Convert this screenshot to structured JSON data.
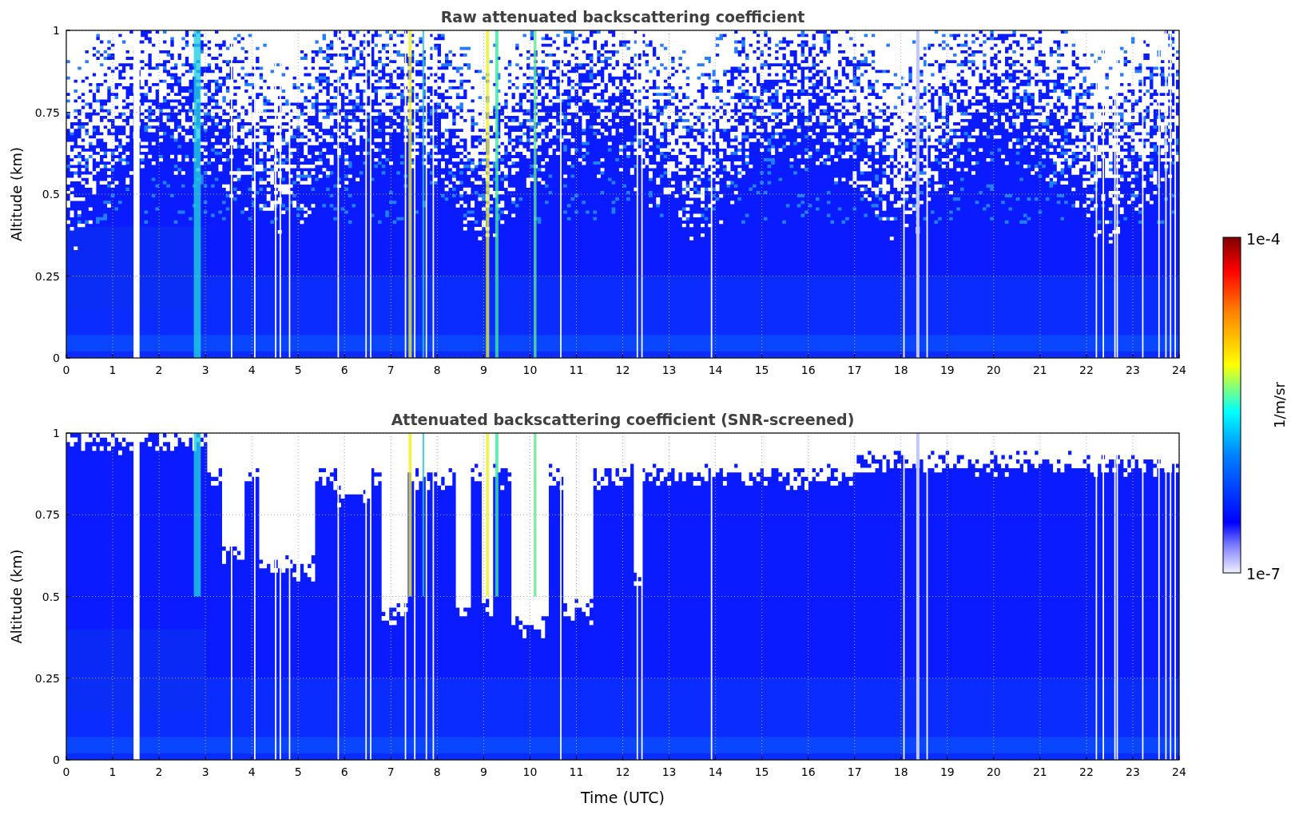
{
  "plots": [
    {
      "title": "Raw attenuated backscattering coefficient",
      "ylabel": "Altitude (km)",
      "yticks": [
        "1",
        "0.75",
        "0.5",
        "0.25",
        "0"
      ],
      "xticks": [
        "0",
        "1",
        "2",
        "3",
        "4",
        "5",
        "6",
        "7",
        "8",
        "9",
        "10",
        "11",
        "12",
        "13",
        "14",
        "15",
        "16",
        "17",
        "18",
        "19",
        "20",
        "21",
        "22",
        "23",
        "24"
      ],
      "screened": false
    },
    {
      "title": "Attenuated backscattering coefficient (SNR-screened)",
      "ylabel": "Altitude (km)",
      "yticks": [
        "1",
        "0.75",
        "0.5",
        "0.25",
        "0"
      ],
      "xticks": [
        "0",
        "1",
        "2",
        "3",
        "4",
        "5",
        "6",
        "7",
        "8",
        "9",
        "10",
        "11",
        "12",
        "13",
        "14",
        "15",
        "16",
        "17",
        "18",
        "19",
        "20",
        "21",
        "22",
        "23",
        "24"
      ],
      "screened": true
    }
  ],
  "xlabel": "Time (UTC)",
  "colorbar": {
    "label": "1/m/sr",
    "max_label": "1e-4",
    "min_label": "1e-7"
  }
}
